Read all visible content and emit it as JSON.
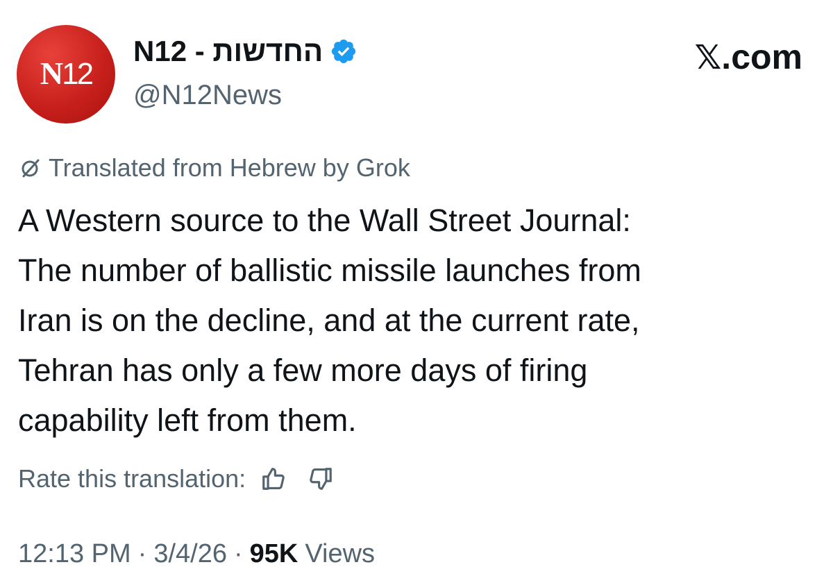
{
  "post": {
    "author": {
      "avatar_text_letter": "N",
      "avatar_text_number": "12",
      "display_name": "N12 - החדשות",
      "handle": "@N12News",
      "verified_icon": "verified-badge-icon",
      "avatar_color": "#c8201c"
    },
    "brand": {
      "x_glyph": "𝕏",
      "domain": ".com"
    },
    "translation_notice": {
      "icon": "grok-icon",
      "text": "Translated from Hebrew by Grok"
    },
    "body_lines": [
      "A Western source to the Wall Street Journal:",
      "The number of ballistic missile launches from",
      "Iran is on the decline, and at the current rate,",
      "Tehran has only a few more days of firing",
      "capability left from them."
    ],
    "rate": {
      "label": "Rate this translation:",
      "thumbs_up_icon": "thumbs-up-icon",
      "thumbs_down_icon": "thumbs-down-icon"
    },
    "meta": {
      "time": "12:13 PM",
      "separator": "·",
      "date": "3/4/26",
      "views_count": "95K",
      "views_label": "Views"
    }
  },
  "colors": {
    "text_primary": "#0f1419",
    "text_secondary": "#536471",
    "verified_blue": "#1d9bf0"
  }
}
